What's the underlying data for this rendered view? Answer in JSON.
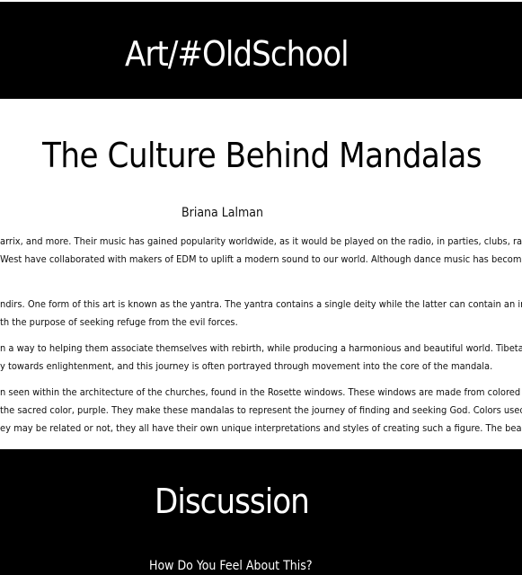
{
  "header": {
    "site_title": "Art/#OldSchool"
  },
  "article": {
    "title": "The Culture Behind Mandalas",
    "author": "Briana Lalman",
    "paragraphs": [
      [
        "arrix, and more. Their music has gained popularity worldwide, as it would be played on the radio, in parties, clubs, raves, etc. EDM has g",
        "West have collaborated with makers of EDM to uplift a modern sound to our world. Although dance music has become a major part of ou"
      ],
      [
        "ndirs. One form of this art is known as the yantra. The yantra contains a single deity while the latter can contain an infinite number. Hind",
        "th the purpose of seeking refuge from the evil forces."
      ],
      [
        "n a way to helping them associate themselves with rebirth, while producing a harmonious and beautiful world. Tibetan mandalas follow",
        "y towards enlightenment, and this journey is often portrayed through movement into the core of the mandala."
      ],
      [
        "n seen within the architecture of the churches, found in the Rosette windows. These windows are made from colored glass, produced by",
        " the sacred color, purple. They make these mandalas to represent the journey of finding and seeking God. Colors used represent spiritu",
        "ey may be related or not, they all have their own unique interpretations and styles of creating such a figure. The beauty behind the mand"
      ]
    ]
  },
  "discussion": {
    "title": "Discussion",
    "prompt": "How Do You Feel About This?"
  }
}
